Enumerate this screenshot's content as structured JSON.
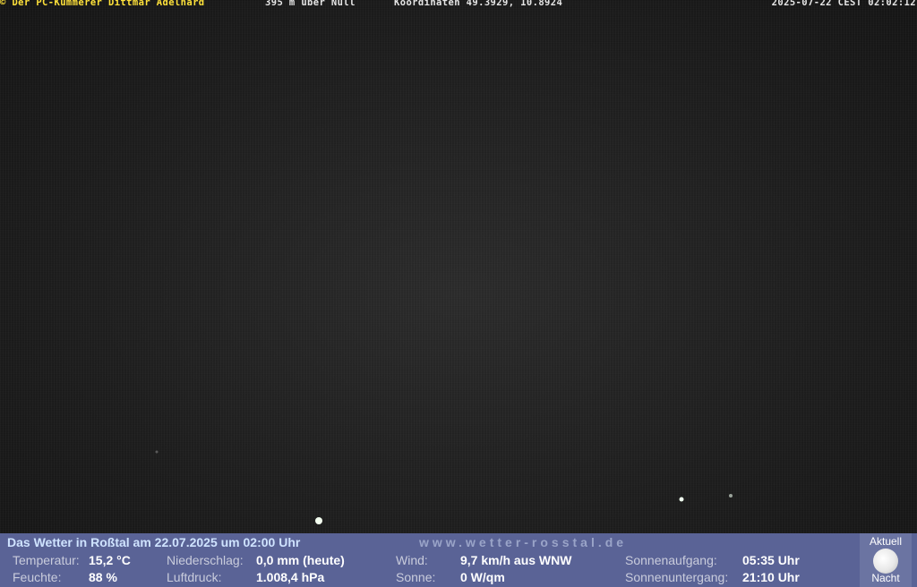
{
  "overlay": {
    "copyright": "© Der PC-Kümmerer Dittmar Adelhard",
    "altitude": "395 m über Null",
    "coordinates": "Koordinaten 49.3929, 10.8924",
    "timestamp": "2025-07-22 CEST 02:02:12"
  },
  "weather": {
    "headline": "Das Wetter in Roßtal am 22.07.2025 um 02:00 Uhr",
    "site": "www.wetter-rosstal.de",
    "temperature_label": "Temperatur:",
    "temperature_value": "15,2 °C",
    "humidity_label": "Feuchte:",
    "humidity_value": "88 %",
    "precipitation_label": "Niederschlag:",
    "precipitation_value": "0,0 mm (heute)",
    "pressure_label": "Luftdruck:",
    "pressure_value": "1.008,4 hPa",
    "wind_label": "Wind:",
    "wind_value": "9,7 km/h aus WNW",
    "sun_label": "Sonne:",
    "sun_value": "0 W/qm",
    "sunrise_label": "Sonnenaufgang:",
    "sunrise_value": "05:35 Uhr",
    "sunset_label": "Sonnenuntergang:",
    "sunset_value": "21:10 Uhr",
    "moon_top": "Aktuell",
    "moon_bottom": "Nacht",
    "moon_icon": "full-moon-icon"
  },
  "colors": {
    "overlay_copyright": "#ffe23a",
    "overlay_text": "#e6e6e6",
    "bar_background": "#5a6396",
    "headline": "#cfe3ff"
  }
}
